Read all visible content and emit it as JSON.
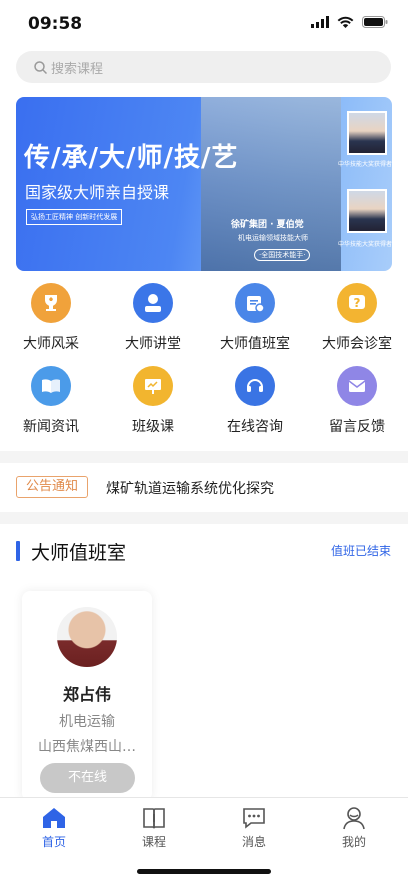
{
  "status_bar": {
    "time": "09:58"
  },
  "search": {
    "placeholder": "搜索课程",
    "icon": "search-icon"
  },
  "banner": {
    "title": "传/承/大/师/技/艺",
    "subtitle": "国家级大师亲自授课",
    "tag": "弘扬工匠精神 创新时代发展",
    "person_name": "徐矿集团 · 夏伯党",
    "person_role": "机电运输领域技能大师",
    "person_award": "·全国技术能手·",
    "portrait_1_caption": "中华技能大奖获得者",
    "portrait_2_caption": "中华技能大奖获得者"
  },
  "grid": [
    {
      "label": "大师风采",
      "icon": "trophy-icon",
      "color": "#f0a23b"
    },
    {
      "label": "大师讲堂",
      "icon": "lecturer-icon",
      "color": "#3b76e8"
    },
    {
      "label": "大师值班室",
      "icon": "schedule-icon",
      "color": "#4a86e8"
    },
    {
      "label": "大师会诊室",
      "icon": "question-icon",
      "color": "#f3b431"
    },
    {
      "label": "新闻资讯",
      "icon": "book-icon",
      "color": "#4b9be9"
    },
    {
      "label": "班级课",
      "icon": "whiteboard-icon",
      "color": "#f2b52f"
    },
    {
      "label": "在线咨询",
      "icon": "headset-icon",
      "color": "#3a74e4"
    },
    {
      "label": "留言反馈",
      "icon": "mail-icon",
      "color": "#8f86e6"
    }
  ],
  "notice": {
    "tag": "公告通知",
    "text": "煤矿轨道运输系统优化探究"
  },
  "section": {
    "title": "大师值班室",
    "more": "值班已结束"
  },
  "card": {
    "name": "郑占伟",
    "field": "机电运输",
    "org": "山西焦煤西山…",
    "status": "不在线"
  },
  "tabbar": [
    {
      "label": "首页",
      "icon": "home-icon",
      "active": true
    },
    {
      "label": "课程",
      "icon": "course-icon",
      "active": false
    },
    {
      "label": "消息",
      "icon": "message-icon",
      "active": false
    },
    {
      "label": "我的",
      "icon": "profile-icon",
      "active": false
    }
  ],
  "colors": {
    "accent": "#2f64e6",
    "notice": "#e08a4a",
    "offline": "#c8c8c8"
  }
}
